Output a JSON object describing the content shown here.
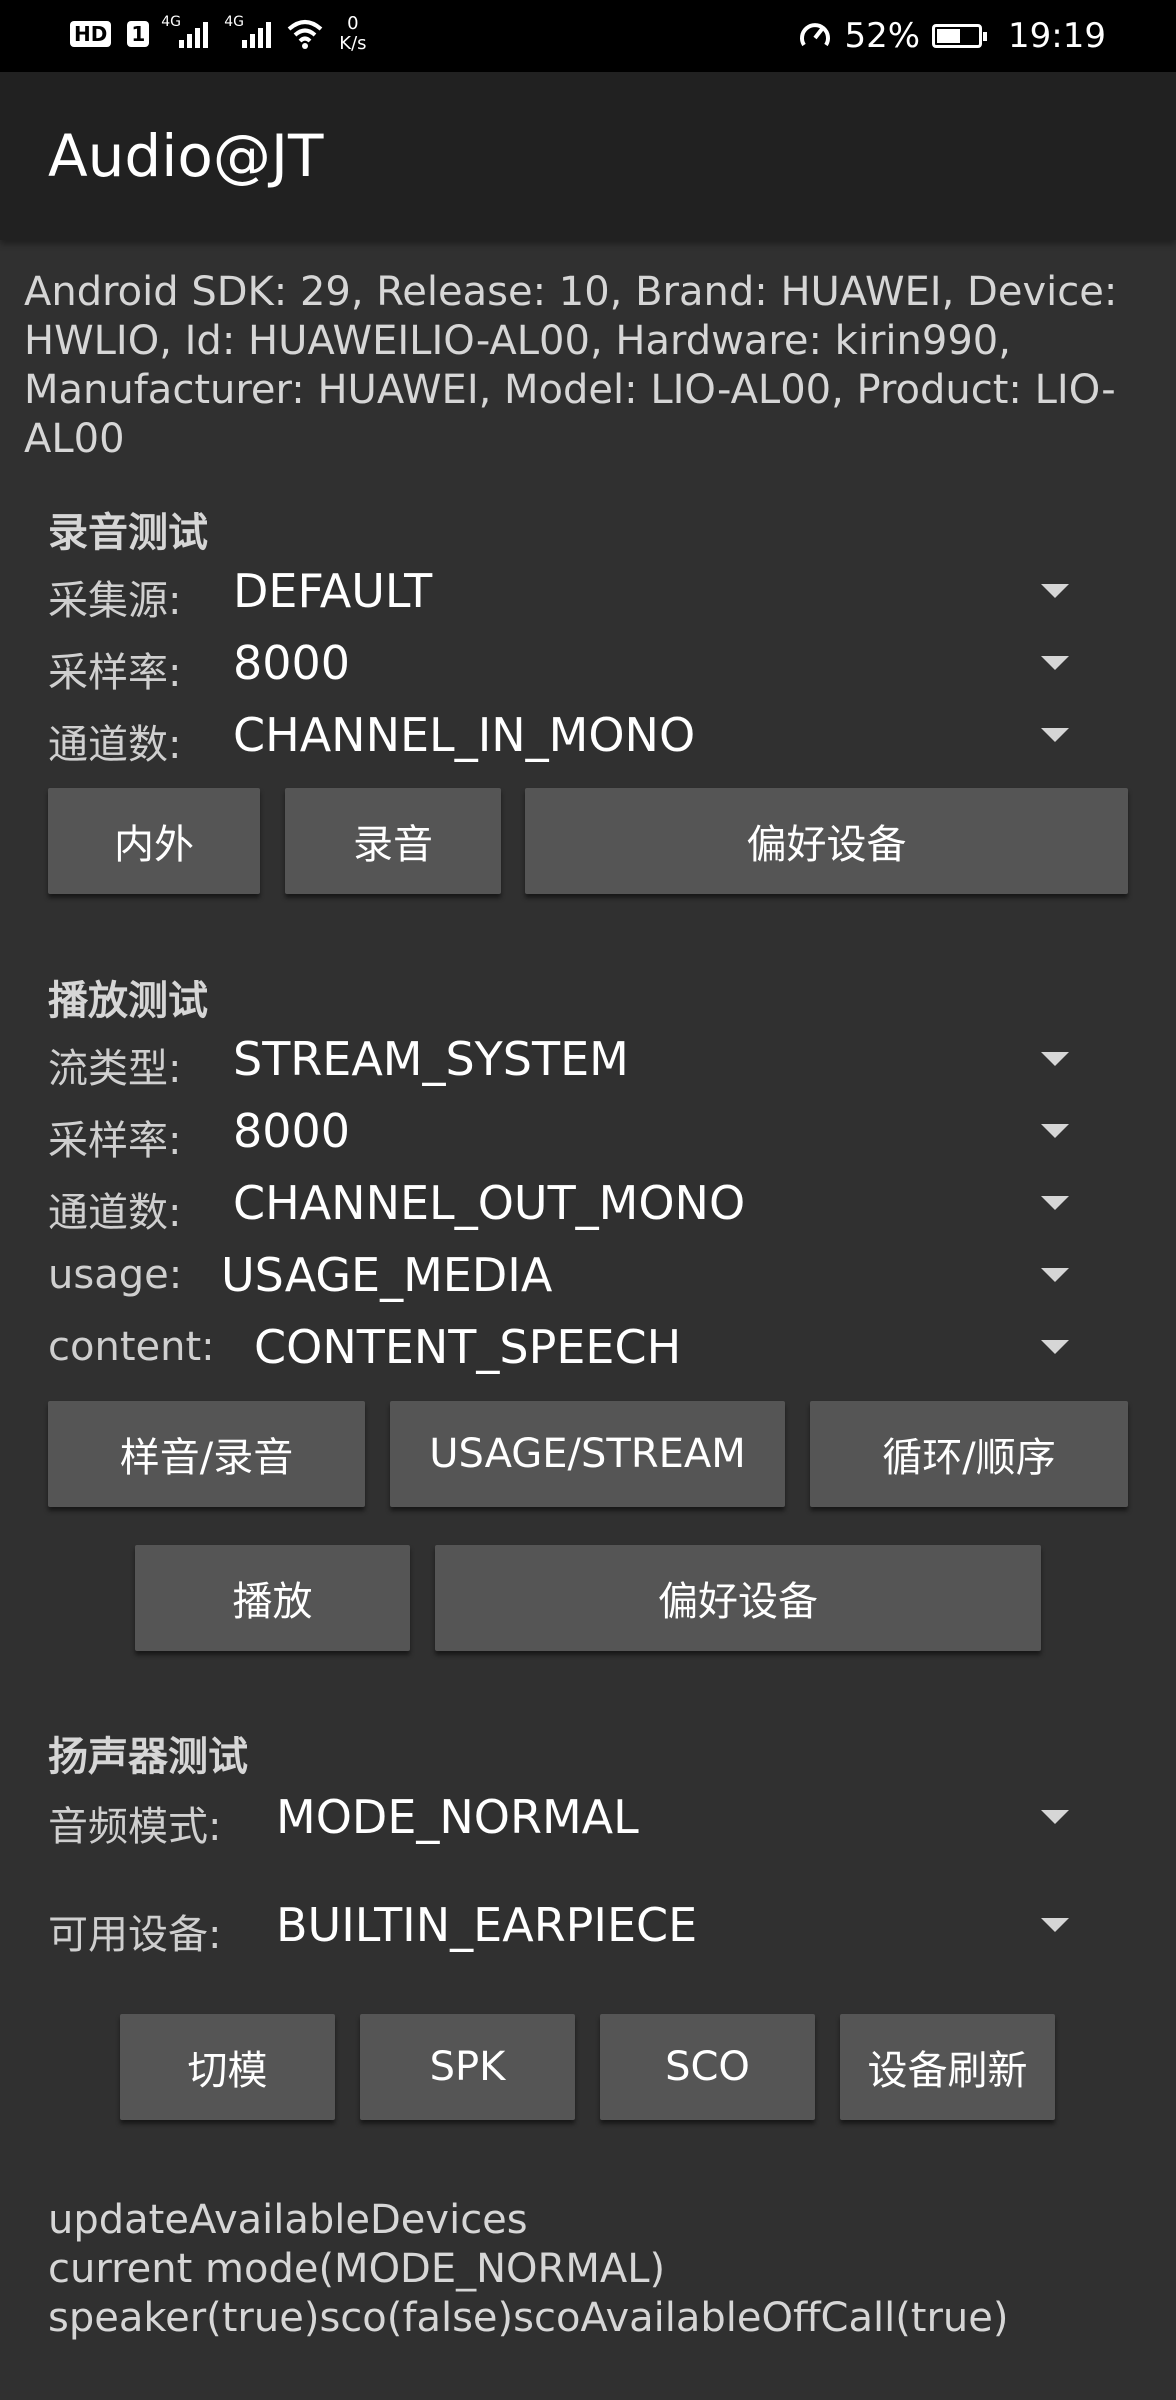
{
  "status_bar": {
    "hd": "HD",
    "sim1": "1",
    "net_tag_1": "4G",
    "net_tag_2": "4G",
    "speed_value": "0",
    "speed_unit": "K/s",
    "battery_percent": "52%",
    "battery_level": 0.52,
    "time": "19:19",
    "icons": [
      "hd-icon",
      "signal-icon",
      "signal-icon",
      "wifi-icon",
      "speedometer-icon",
      "battery-charging-icon"
    ]
  },
  "app_bar": {
    "title": "Audio@JT"
  },
  "device_info": "Android SDK: 29, Release: 10, Brand: HUAWEI, Device: HWLIO, Id: HUAWEILIO-AL00, Hardware: kirin990, Manufacturer: HUAWEI, Model: LIO-AL00, Product: LIO-AL00",
  "record": {
    "title": "录音测试",
    "rows": [
      {
        "label": "采集源:",
        "value": "DEFAULT"
      },
      {
        "label": "采样率:",
        "value": "8000"
      },
      {
        "label": "通道数:",
        "value": "CHANNEL_IN_MONO"
      }
    ],
    "buttons": {
      "inner_outer": "内外",
      "record": "录音",
      "preferred": "偏好设备"
    }
  },
  "playback": {
    "title": "播放测试",
    "rows": [
      {
        "label": "流类型:",
        "value": "STREAM_SYSTEM"
      },
      {
        "label": "采样率:",
        "value": "8000"
      },
      {
        "label": "通道数:",
        "value": "CHANNEL_OUT_MONO"
      },
      {
        "label": "usage:",
        "value": "USAGE_MEDIA"
      },
      {
        "label": "content:",
        "value": "CONTENT_SPEECH"
      }
    ],
    "buttons": {
      "sample_record": "样音/录音",
      "usage_stream": "USAGE/STREAM",
      "loop_order": "循环/顺序",
      "play": "播放",
      "preferred": "偏好设备"
    }
  },
  "speaker": {
    "title": "扬声器测试",
    "rows": [
      {
        "label": "音频模式:",
        "value": "MODE_NORMAL"
      },
      {
        "label": "可用设备:",
        "value": "BUILTIN_EARPIECE"
      }
    ],
    "buttons": {
      "switch_mode": "切模",
      "spk": "SPK",
      "sco": "SCO",
      "refresh": "设备刷新"
    }
  },
  "log": [
    "updateAvailableDevices",
    "current mode(MODE_NORMAL)",
    "speaker(true)sco(false)scoAvailableOffCall(true)"
  ]
}
